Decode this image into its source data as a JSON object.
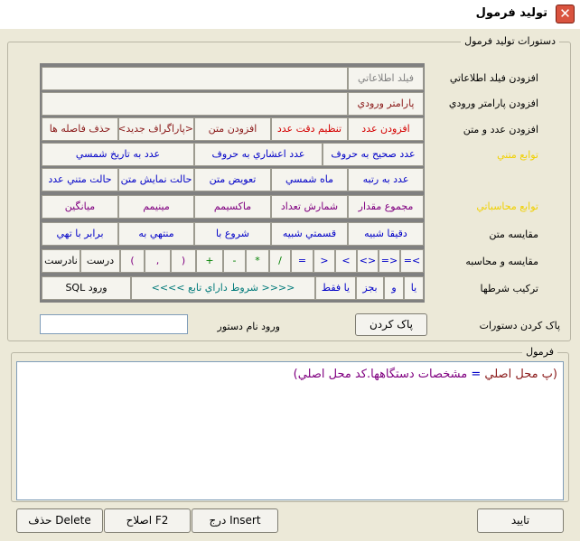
{
  "window": {
    "title": "توليد فرمول",
    "close_glyph": "✕"
  },
  "commands_group": {
    "legend": "دستورات توليد فرمول"
  },
  "formula_group": {
    "legend": "فرمول"
  },
  "rows": {
    "r1": {
      "label": "افزودن فيلد اطلاعاتي",
      "button": "فيلد اطلاعاتي"
    },
    "r2": {
      "label": "افزودن پارامتر ورودي",
      "button": "پارامتر ورودي"
    },
    "r3": {
      "label": "افزودن عدد و متن",
      "buttons": [
        "افزودن عدد",
        "تنظيم دقت عدد",
        "افزودن متن",
        "<پاراگراف جديد>",
        "حذف فاصله ها"
      ]
    },
    "r4": {
      "label": "توابع متني",
      "buttons": [
        "عدد صحيح به حروف",
        "عدد اعشاري به حروف",
        "عدد به تاريخ شمسي"
      ]
    },
    "r5": {
      "buttons": [
        "عدد به رتبه",
        "ماه شمسي",
        "تعويض متن",
        "حالت نمايش متن",
        "حالت متني عدد"
      ]
    },
    "r6": {
      "label": "توابع محاسباتي",
      "buttons": [
        "مجموع مقدار",
        "شمارش تعداد",
        "ماکسيمم",
        "مينيمم",
        "ميانگين"
      ]
    },
    "r7": {
      "label": "مقايسه متن",
      "buttons": [
        "دقيقا شبيه",
        "قسمتي شبيه",
        "شروع با",
        "منتهي به",
        "برابر با تهي"
      ]
    },
    "r8": {
      "label": "مقايسه و محاسبه",
      "buttons": [
        ">=",
        "<=",
        "<>",
        ">",
        "<",
        "=",
        "/",
        "*",
        "-",
        "+",
        "(",
        ",",
        ")",
        "درست",
        "نادرست"
      ]
    },
    "r9": {
      "label": "ترکيب شرطها",
      "buttons": [
        "يا",
        "و",
        "بجز",
        "يا فقط",
        "<<<< شروط داراي تابع >>>>",
        "ورود SQL"
      ]
    }
  },
  "clear": {
    "label": "پاک کردن دستورات",
    "button": "پاک کردن"
  },
  "command_name": {
    "label": "ورود نام دستور",
    "value": ""
  },
  "formula": {
    "part1": "(پ محل اصلي",
    "op": "=",
    "part2": "مشخصات دستگاهها.کد محل اصلي)"
  },
  "footer": {
    "ok": "تاييد",
    "insert": "درج  Insert",
    "edit": "اصلاح  F2",
    "delete": "حذف  Delete"
  },
  "colors": {
    "accent_yellow": "#f0d000",
    "panel_gray": "#808080",
    "red": "#d40000",
    "blue": "#0000c8",
    "purple": "#800080"
  }
}
